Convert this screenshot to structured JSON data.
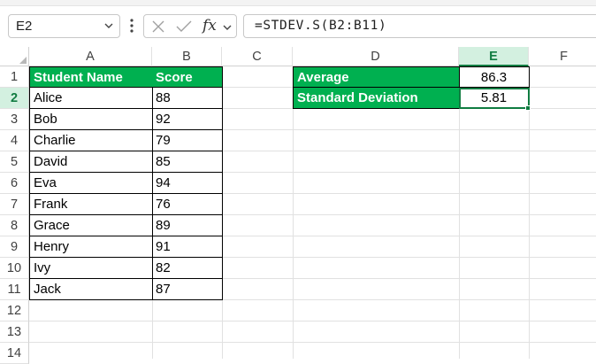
{
  "formula_bar": {
    "name_box": "E2",
    "formula": "=STDEV.S(B2:B11)",
    "fx_label": "fx"
  },
  "columns": [
    "A",
    "B",
    "C",
    "D",
    "E",
    "F"
  ],
  "rows": [
    "1",
    "2",
    "3",
    "4",
    "5",
    "6",
    "7",
    "8",
    "9",
    "10",
    "11",
    "12",
    "13",
    "14"
  ],
  "student_table": {
    "headers": [
      "Student Name",
      "Score"
    ],
    "rows": [
      [
        "Alice",
        "88"
      ],
      [
        "Bob",
        "92"
      ],
      [
        "Charlie",
        "79"
      ],
      [
        "David",
        "85"
      ],
      [
        "Eva",
        "94"
      ],
      [
        "Frank",
        "76"
      ],
      [
        "Grace",
        "89"
      ],
      [
        "Henry",
        "91"
      ],
      [
        "Ivy",
        "82"
      ],
      [
        "Jack",
        "87"
      ]
    ]
  },
  "stats_table": {
    "rows": [
      [
        "Average",
        "86.3"
      ],
      [
        "Standard Deviation",
        "5.81"
      ]
    ]
  },
  "colors": {
    "header_fill": "#00b050",
    "accent": "#107c41"
  }
}
